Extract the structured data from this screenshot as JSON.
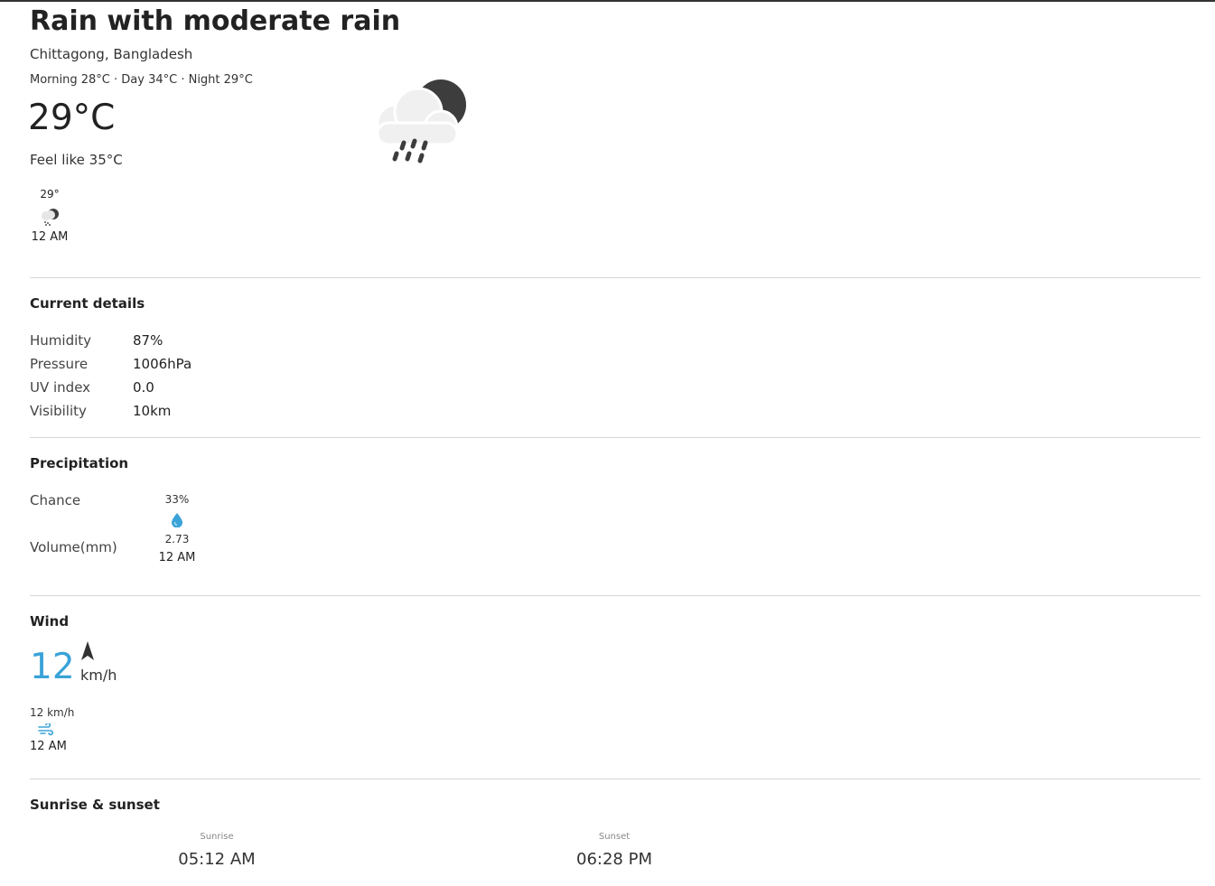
{
  "header": {
    "title": "Rain with moderate rain",
    "location": "Chittagong, Bangladesh",
    "daily_temps": "Morning 28°C · Day 34°C · Night 29°C",
    "current_temp": "29°C",
    "feels_like": "Feel like 35°C",
    "main_icon": "rain-night-cloud-icon"
  },
  "hourly": [
    {
      "temp": "29°",
      "icon": "rain-night-small-icon",
      "time": "12 AM"
    }
  ],
  "details": {
    "title": "Current details",
    "rows": [
      {
        "label": "Humidity",
        "value": "87%"
      },
      {
        "label": "Pressure",
        "value": "1006hPa"
      },
      {
        "label": "UV index",
        "value": "0.0"
      },
      {
        "label": "Visibility",
        "value": "10km"
      }
    ]
  },
  "precipitation": {
    "title": "Precipitation",
    "chance_label": "Chance",
    "volume_label": "Volume(mm)",
    "hours": [
      {
        "chance": "33%",
        "volume": "2.73",
        "time": "12 AM",
        "icon": "water-drop-icon"
      }
    ],
    "accent": "#3aa3d8"
  },
  "wind": {
    "title": "Wind",
    "speed": "12",
    "unit": "km/h",
    "direction_icon": "navigation-arrow-icon",
    "hours": [
      {
        "speed": "12 km/h",
        "time": "12 AM",
        "icon": "wind-icon"
      }
    ],
    "accent": "#3aa3d8"
  },
  "sun": {
    "title": "Sunrise & sunset",
    "sunrise_label": "Sunrise",
    "sunrise": "05:12 AM",
    "sunset_label": "Sunset",
    "sunset": "06:28 PM"
  }
}
